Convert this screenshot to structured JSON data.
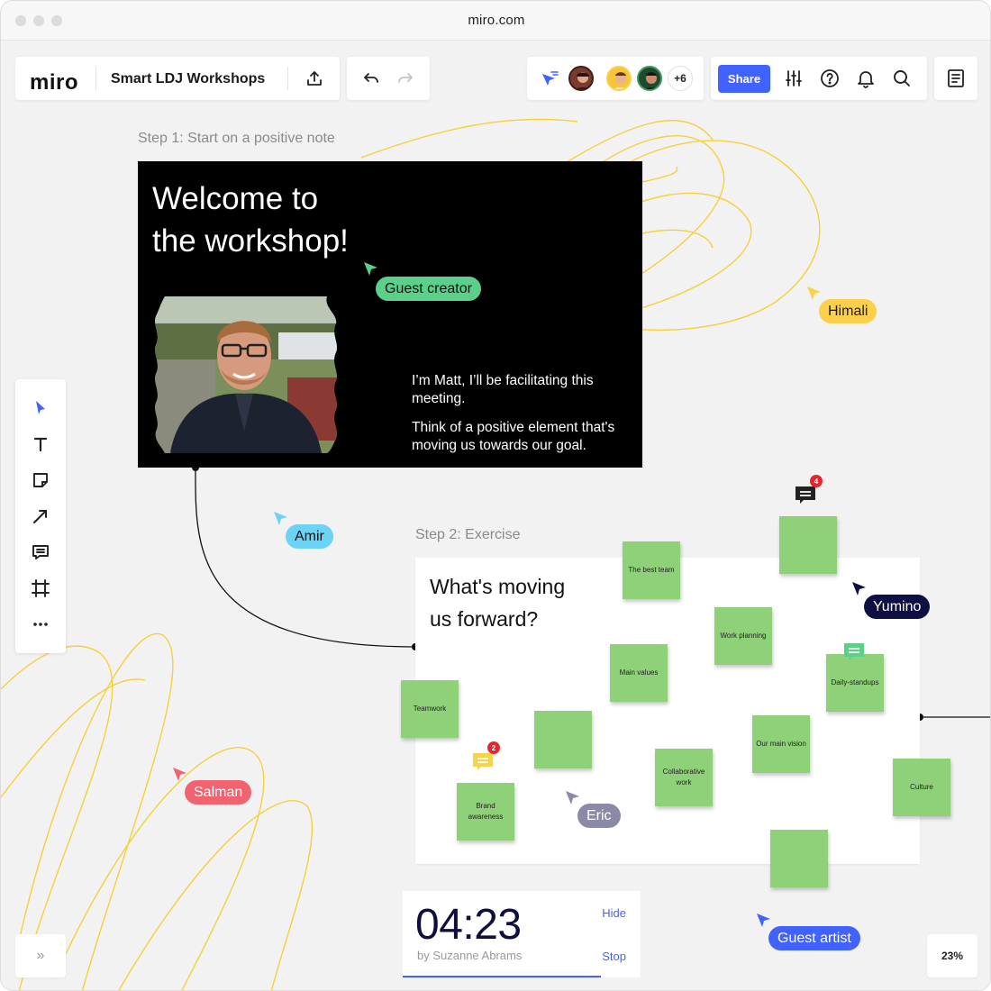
{
  "browser": {
    "url": "miro.com"
  },
  "header": {
    "logo": "miro",
    "board_name": "Smart LDJ Workshops",
    "more_users": "+6",
    "share_label": "Share"
  },
  "board": {
    "step1_label": "Step 1: Start on a positive note",
    "welcome_line1": "Welcome to",
    "welcome_line2": "the workshop!",
    "intro_p1": "I’m Matt, I’ll be facilitating this meeting.",
    "intro_p2": "Think of a positive element that's moving us towards our goal.",
    "step2_label": "Step 2: Exercise",
    "exercise_line1": "What's moving",
    "exercise_line2": "us forward?",
    "stickies": [
      "The best team",
      "",
      "Work planning",
      "Main values",
      "Daily-standups",
      "Teamwork",
      "",
      "Our main vision",
      "Collaborative work",
      "Culture",
      "Brand awareness",
      ""
    ],
    "comment_counts": [
      "4",
      "2"
    ]
  },
  "cursors": {
    "guest_creator": "Guest creator",
    "himali": "Himali",
    "amir": "Amir",
    "yumino": "Yumino",
    "salman": "Salman",
    "eric": "Eric",
    "guest_artist": "Guest artist"
  },
  "timer": {
    "time": "04:23",
    "by": "by Suzanne Abrams",
    "hide": "Hide",
    "stop": "Stop"
  },
  "footer": {
    "expand": "»",
    "zoom": "23%"
  },
  "colors": {
    "accent": "#4262ff",
    "sticky": "#8fd178",
    "guest_creator": "#5ad08a",
    "himali": "#fcd04a",
    "amir": "#6dd3f5",
    "yumino": "#0e1044",
    "salman": "#f1646f",
    "eric": "#8a8aa6",
    "guest_artist": "#4262ff",
    "scribble": "#f7cf3b"
  }
}
